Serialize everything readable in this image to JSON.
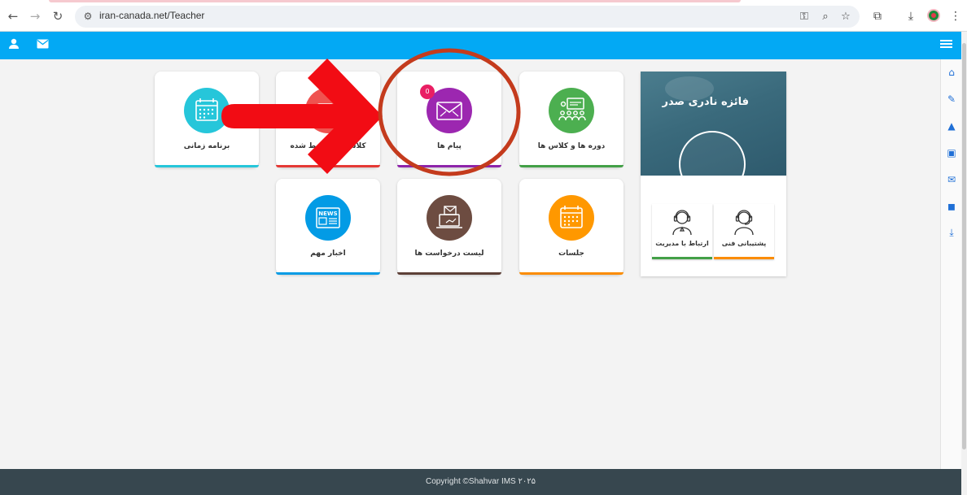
{
  "browser": {
    "url": "iran-canada.net/Teacher"
  },
  "tiles": [
    {
      "label": "برنامه زمانی",
      "icon": "calendar-icon",
      "color": "#26c6da",
      "stripe": "#26c6da"
    },
    {
      "label": "کلاس های ضبط شده",
      "icon": "video-icon",
      "color": "#ef5350",
      "stripe": "#e53935"
    },
    {
      "label": "پیام ها",
      "icon": "envelope-icon",
      "color": "#9c27b0",
      "stripe": "#8e24aa",
      "badge": "0"
    },
    {
      "label": "دوره ها و کلاس ها",
      "icon": "classroom-icon",
      "color": "#4caf50",
      "stripe": "#43a047"
    },
    {
      "label": "اخبار مهم",
      "icon": "news-icon",
      "color": "#039be5",
      "stripe": "#039be5"
    },
    {
      "label": "لیست درخواست ها",
      "icon": "laptop-mail-icon",
      "color": "#6d4c41",
      "stripe": "#5d4037"
    },
    {
      "label": "جلسات",
      "icon": "calendar-icon",
      "color": "#ff9800",
      "stripe": "#fb8c00"
    }
  ],
  "profile": {
    "name": "فائزه نادری صدر",
    "links": [
      {
        "label": "ارتباط با مدیریت",
        "icon": "headset-agent-icon",
        "stripe": "#43a047"
      },
      {
        "label": "پشتیبانی فنی",
        "icon": "headset-support-icon",
        "stripe": "#fb8c00"
      }
    ]
  },
  "footer": {
    "copyright": "Copyright ©Shahvar IMS ۲۰۲۵"
  }
}
